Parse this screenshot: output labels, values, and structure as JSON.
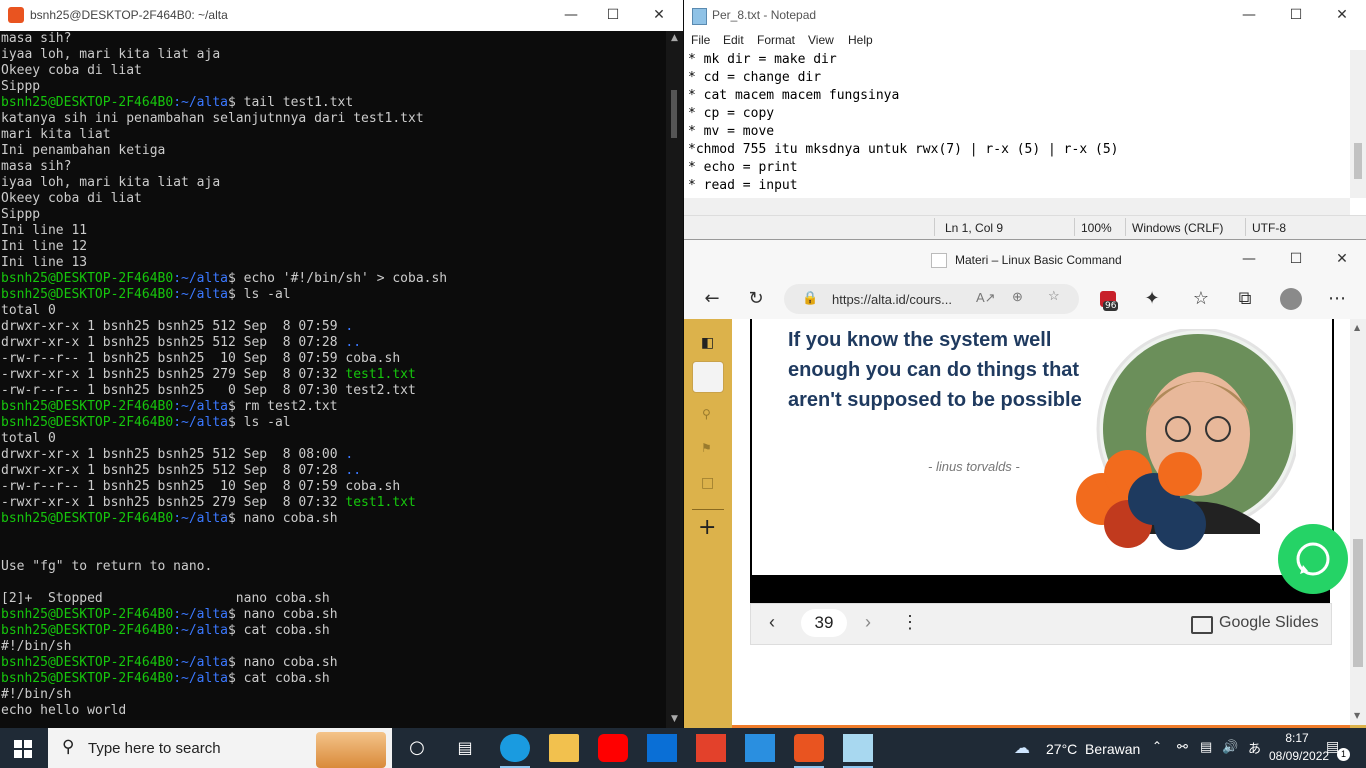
{
  "terminal": {
    "title": "bsnh25@DESKTOP-2F464B0: ~/alta",
    "prompt_user": "bsnh25@DESKTOP-2F464B0",
    "prompt_path": ":~/alta",
    "lines": [
      {
        "t": "out",
        "text": "masa sih?"
      },
      {
        "t": "out",
        "text": "iyaa loh, mari kita liat aja"
      },
      {
        "t": "out",
        "text": "Okeey coba di liat"
      },
      {
        "t": "out",
        "text": "Sippp"
      },
      {
        "t": "cmd",
        "text": "$ tail test1.txt"
      },
      {
        "t": "out",
        "text": "katanya sih ini penambahan selanjutnnya dari test1.txt"
      },
      {
        "t": "out",
        "text": "mari kita liat"
      },
      {
        "t": "out",
        "text": "Ini penambahan ketiga"
      },
      {
        "t": "out",
        "text": "masa sih?"
      },
      {
        "t": "out",
        "text": "iyaa loh, mari kita liat aja"
      },
      {
        "t": "out",
        "text": "Okeey coba di liat"
      },
      {
        "t": "out",
        "text": "Sippp"
      },
      {
        "t": "out",
        "text": "Ini line 11"
      },
      {
        "t": "out",
        "text": "Ini line 12"
      },
      {
        "t": "out",
        "text": "Ini line 13"
      },
      {
        "t": "cmd",
        "text": "$ echo '#!/bin/sh' > coba.sh"
      },
      {
        "t": "cmd",
        "text": "$ ls -al"
      },
      {
        "t": "out",
        "text": "total 0"
      },
      {
        "t": "ls",
        "text": "drwxr-xr-x 1 bsnh25 bsnh25 512 Sep  8 07:59 ",
        "name": ".",
        "c": "pb"
      },
      {
        "t": "ls",
        "text": "drwxr-xr-x 1 bsnh25 bsnh25 512 Sep  8 07:28 ",
        "name": "..",
        "c": "pb"
      },
      {
        "t": "ls",
        "text": "-rw-r--r-- 1 bsnh25 bsnh25  10 Sep  8 07:59 ",
        "name": "coba.sh",
        "c": "pw"
      },
      {
        "t": "ls",
        "text": "-rwxr-xr-x 1 bsnh25 bsnh25 279 Sep  8 07:32 ",
        "name": "test1.txt",
        "c": "pg"
      },
      {
        "t": "ls",
        "text": "-rw-r--r-- 1 bsnh25 bsnh25   0 Sep  8 07:30 ",
        "name": "test2.txt",
        "c": "pw"
      },
      {
        "t": "cmd",
        "text": "$ rm test2.txt"
      },
      {
        "t": "cmd",
        "text": "$ ls -al"
      },
      {
        "t": "out",
        "text": "total 0"
      },
      {
        "t": "ls",
        "text": "drwxr-xr-x 1 bsnh25 bsnh25 512 Sep  8 08:00 ",
        "name": ".",
        "c": "pb"
      },
      {
        "t": "ls",
        "text": "drwxr-xr-x 1 bsnh25 bsnh25 512 Sep  8 07:28 ",
        "name": "..",
        "c": "pb"
      },
      {
        "t": "ls",
        "text": "-rw-r--r-- 1 bsnh25 bsnh25  10 Sep  8 07:59 ",
        "name": "coba.sh",
        "c": "pw"
      },
      {
        "t": "ls",
        "text": "-rwxr-xr-x 1 bsnh25 bsnh25 279 Sep  8 07:32 ",
        "name": "test1.txt",
        "c": "pg"
      },
      {
        "t": "cmd",
        "text": "$ nano coba.sh"
      },
      {
        "t": "out",
        "text": ""
      },
      {
        "t": "out",
        "text": ""
      },
      {
        "t": "out",
        "text": "Use \"fg\" to return to nano."
      },
      {
        "t": "out",
        "text": ""
      },
      {
        "t": "out",
        "text": "[2]+  Stopped                 nano coba.sh"
      },
      {
        "t": "cmd",
        "text": "$ nano coba.sh"
      },
      {
        "t": "cmd",
        "text": "$ cat coba.sh"
      },
      {
        "t": "out",
        "text": "#!/bin/sh"
      },
      {
        "t": "cmd",
        "text": "$ nano coba.sh"
      },
      {
        "t": "cmd",
        "text": "$ cat coba.sh"
      },
      {
        "t": "out",
        "text": "#!/bin/sh"
      },
      {
        "t": "out",
        "text": "echo hello world"
      }
    ]
  },
  "notepad": {
    "title": "Per_8.txt - Notepad",
    "menu": [
      "File",
      "Edit",
      "Format",
      "View",
      "Help"
    ],
    "lines": [
      "* mk dir = make dir",
      "* cd = change dir",
      "* cat macem macem fungsinya",
      "* cp = copy",
      "* mv = move",
      "*chmod 755 itu mksdnya untuk rwx(7) | r-x (5) | r-x (5)",
      "* echo = print",
      "* read = input"
    ],
    "status": {
      "position": "Ln 1, Col 9",
      "zoom": "100%",
      "eol": "Windows (CRLF)",
      "encoding": "UTF-8"
    }
  },
  "edge": {
    "title": "Materi – Linux Basic Command",
    "url": "https://alta.id/cours...",
    "badge": "96",
    "slide": {
      "quote": "If you know the system well enough you can do things that aren't supposed to be possible",
      "author": "- linus torvalds -",
      "page": "39",
      "brand": "Google Slides"
    }
  },
  "taskbar": {
    "search_placeholder": "Type here to search",
    "weather": "27°C  Berawan",
    "time": "8:17",
    "date": "08/09/2022",
    "notif_count": "1"
  },
  "colors": {
    "prompt_green": "#16c60c",
    "dir_blue": "#3b78ff",
    "lms_gold": "#dcb24b",
    "orange": "#f07c2a",
    "whatsapp": "#25d366"
  }
}
